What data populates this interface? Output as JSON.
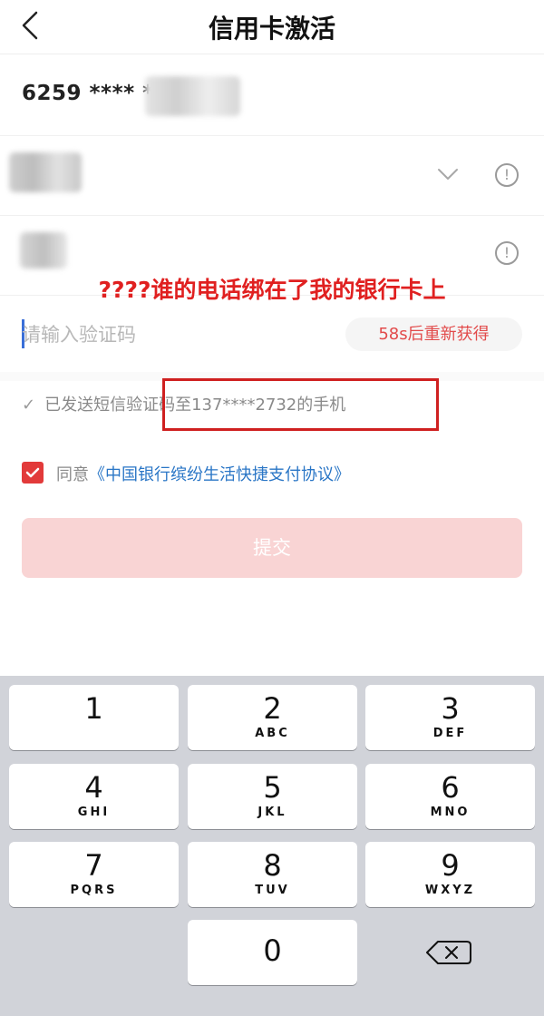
{
  "nav": {
    "title": "信用卡激活",
    "back_icon": "chevron-left-icon"
  },
  "card": {
    "number_masked": "6259 **** ***"
  },
  "annotation": "????谁的电话绑在了我的银行卡上",
  "verify": {
    "placeholder": "请输入验证码",
    "resend_label": "58s后重新获得"
  },
  "sms": {
    "check_icon": "✓",
    "message": "已发送短信验证码至137****2732的手机"
  },
  "agreement": {
    "checked": true,
    "prefix": "同意",
    "link": "《中国银行缤纷生活快捷支付协议》"
  },
  "submit": {
    "label": "提交"
  },
  "keypad": {
    "keys": [
      {
        "digit": "1",
        "letters": ""
      },
      {
        "digit": "2",
        "letters": "ABC"
      },
      {
        "digit": "3",
        "letters": "DEF"
      },
      {
        "digit": "4",
        "letters": "GHI"
      },
      {
        "digit": "5",
        "letters": "JKL"
      },
      {
        "digit": "6",
        "letters": "MNO"
      },
      {
        "digit": "7",
        "letters": "PQRS"
      },
      {
        "digit": "8",
        "letters": "TUV"
      },
      {
        "digit": "9",
        "letters": "WXYZ"
      },
      {
        "digit": "0",
        "letters": ""
      }
    ],
    "delete_icon": "backspace-icon"
  },
  "colors": {
    "accent_red": "#e23a3a",
    "link_blue": "#2a76c6",
    "annotation_red": "#e02020"
  }
}
